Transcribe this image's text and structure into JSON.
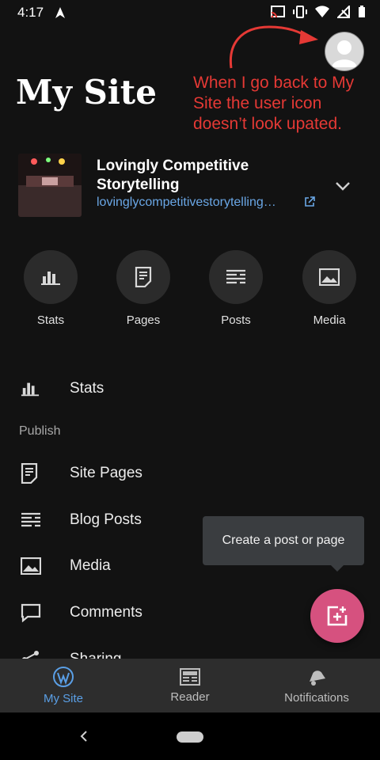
{
  "status_bar": {
    "time": "4:17"
  },
  "header": {
    "title": "My Site"
  },
  "annotation": {
    "text": "When I go back to My Site the user icon doesn’t look upated."
  },
  "site": {
    "name": "Lovingly Competitive Storytelling",
    "url": "lovinglycompetitivestorytelling…"
  },
  "quick_actions": [
    {
      "label": "Stats",
      "icon": "stats-icon"
    },
    {
      "label": "Pages",
      "icon": "pages-icon"
    },
    {
      "label": "Posts",
      "icon": "posts-icon"
    },
    {
      "label": "Media",
      "icon": "media-icon"
    }
  ],
  "menu": {
    "stats_label": "Stats",
    "publish_header": "Publish",
    "items": [
      {
        "label": "Site Pages",
        "icon": "site-pages-icon"
      },
      {
        "label": "Blog Posts",
        "icon": "blog-posts-icon"
      },
      {
        "label": "Media",
        "icon": "media-icon"
      },
      {
        "label": "Comments",
        "icon": "comments-icon"
      },
      {
        "label": "Sharing",
        "icon": "sharing-icon"
      }
    ]
  },
  "tooltip": {
    "text": "Create a post or page"
  },
  "bottom_nav": [
    {
      "label": "My Site",
      "icon": "wordpress-icon",
      "active": true
    },
    {
      "label": "Reader",
      "icon": "reader-icon",
      "active": false
    },
    {
      "label": "Notifications",
      "icon": "bell-icon",
      "active": false
    }
  ],
  "colors": {
    "accent": "#5a9fe6",
    "fab": "#d6517f",
    "annotation": "#e53935",
    "link": "#6aa7e6"
  }
}
